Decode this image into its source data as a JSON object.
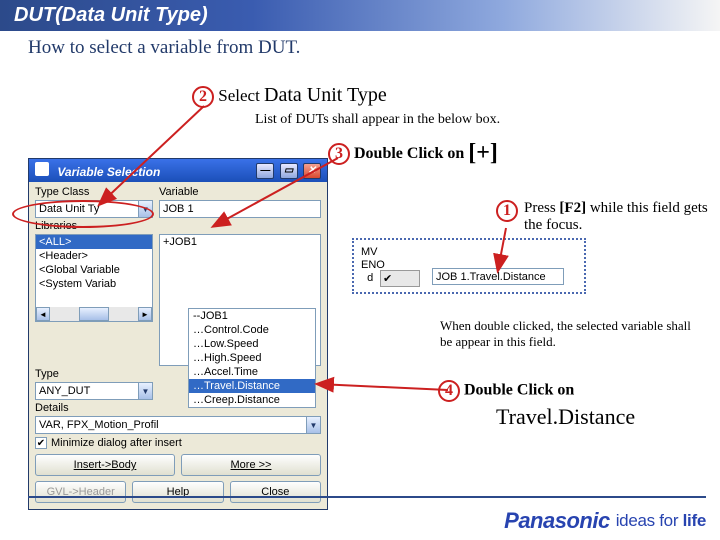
{
  "title": "DUT(Data Unit Type)",
  "subtitle": "How to select a variable from DUT.",
  "step_numbers": {
    "s1": "1",
    "s2": "2",
    "s3": "3",
    "s4": "4"
  },
  "step2": {
    "prefix": "Select ",
    "strong": "Data Unit Type"
  },
  "list_caption": "List of DUTs shall appear in the below box.",
  "step3": {
    "label": "Double Click on ",
    "symbol": "[+]"
  },
  "step1": {
    "prefix": "Press ",
    "key": "[F2]",
    "suffix": " while this field gets the focus."
  },
  "when_text": "When double clicked, the selected variable shall be appear in this field.",
  "step4": {
    "label": "Double Click on",
    "value": "Travel.Distance"
  },
  "dialog": {
    "title": "Variable Selection",
    "lbl_typeclass": "Type Class",
    "lbl_variable": "Variable",
    "lbl_libraries": "Libraries",
    "lbl_type": "Type",
    "lbl_details": "Details",
    "typeclass_value": "Data Unit Ty",
    "variable_value": "JOB 1",
    "tree_root": "+JOB1",
    "libraries": [
      "<ALL>",
      "<Header>",
      "<Global Variable",
      "<System Variab"
    ],
    "type_value": "ANY_DUT",
    "details_value": "VAR, FPX_Motion_Profil",
    "checkbox_label": "Minimize dialog after insert",
    "btn_insert": "Insert->Body",
    "btn_more": "More >>",
    "btn_gvl": "GVL->Header",
    "btn_help": "Help",
    "btn_close": "Close"
  },
  "popup": [
    "--JOB1",
    "…Control.Code",
    "…Low.Speed",
    "…High.Speed",
    "…Accel.Time",
    "…Travel.Distance",
    "…Creep.Distance"
  ],
  "fragment": {
    "mv_lines": "MV\nENO\n  d",
    "tick": "✔",
    "field_value": "JOB 1.Travel.Distance"
  },
  "footer": {
    "brand": "Panasonic",
    "tagline_1": "ideas for ",
    "tagline_2": "life"
  }
}
